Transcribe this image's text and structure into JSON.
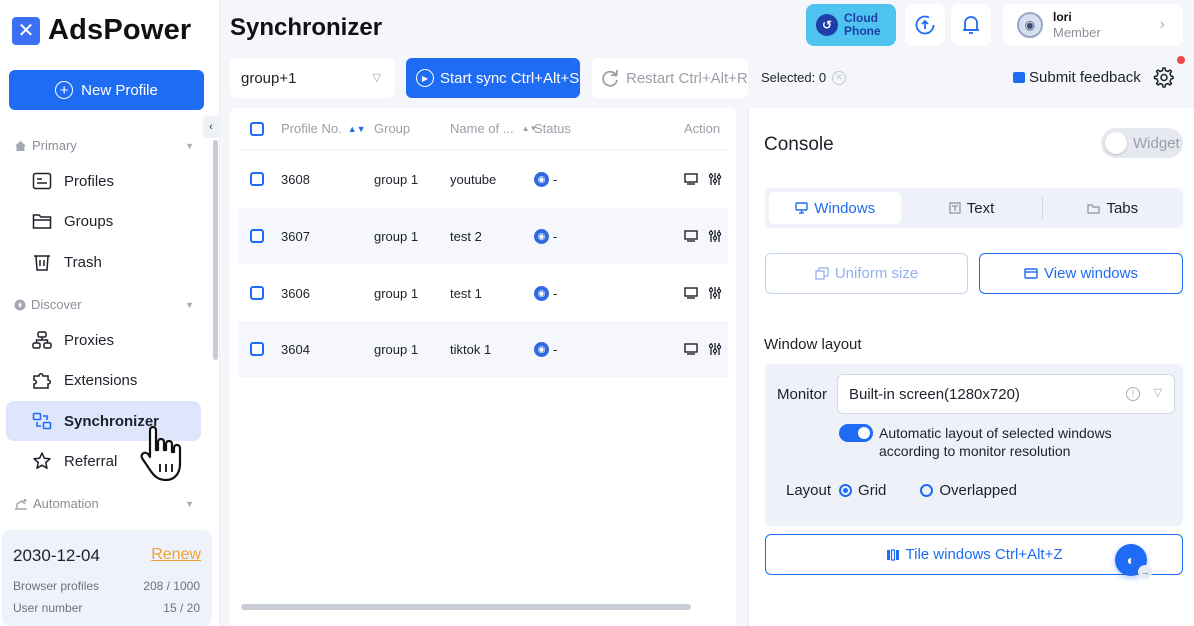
{
  "brand": {
    "name": "AdsPower"
  },
  "sidebar": {
    "new_profile_label": "New Profile",
    "collapse_glyph": "‹",
    "sections": [
      {
        "label": "Primary",
        "icon": "home-icon"
      },
      {
        "label": "Discover",
        "icon": "compass-icon"
      },
      {
        "label": "Automation",
        "icon": "automation-icon"
      }
    ],
    "items": [
      {
        "label": "Profiles",
        "icon": "profiles-icon"
      },
      {
        "label": "Groups",
        "icon": "folder-icon"
      },
      {
        "label": "Trash",
        "icon": "trash-icon"
      },
      {
        "label": "Proxies",
        "icon": "proxies-icon"
      },
      {
        "label": "Extensions",
        "icon": "puzzle-icon"
      },
      {
        "label": "Synchronizer",
        "icon": "sync-icon",
        "active": true
      },
      {
        "label": "Referral",
        "icon": "star-icon"
      }
    ],
    "account": {
      "expiry_date": "2030-12-04",
      "renew_label": "Renew",
      "browser_profiles_label": "Browser profiles",
      "browser_profiles_value": "208 / 1000",
      "user_number_label": "User number",
      "user_number_value": "15 / 20"
    }
  },
  "header": {
    "title": "Synchronizer",
    "cloud_phone": {
      "line1": "Cloud",
      "line2": "Phone"
    },
    "user": {
      "name": "lori",
      "role": "Member"
    }
  },
  "toolbar": {
    "group_value": "group+1",
    "start_sync_label": "Start sync Ctrl+Alt+S",
    "restart_label": "Restart Ctrl+Alt+R",
    "selected_label": "Selected: 0",
    "feedback_label": "Submit feedback"
  },
  "table": {
    "headers": {
      "profile_no": "Profile No.",
      "group": "Group",
      "name": "Name of ...",
      "status": "Status",
      "action": "Action"
    },
    "rows": [
      {
        "profile_no": "3608",
        "group": "group 1",
        "name": "youtube",
        "status": "-"
      },
      {
        "profile_no": "3607",
        "group": "group 1",
        "name": "test 2",
        "status": "-"
      },
      {
        "profile_no": "3606",
        "group": "group 1",
        "name": "test 1",
        "status": "-"
      },
      {
        "profile_no": "3604",
        "group": "group 1",
        "name": "tiktok 1",
        "status": "-"
      }
    ]
  },
  "console": {
    "title": "Console",
    "widget_label": "Widget",
    "tabs": [
      {
        "label": "Windows",
        "active": true
      },
      {
        "label": "Text"
      },
      {
        "label": "Tabs"
      }
    ],
    "uniform_size_label": "Uniform size",
    "view_windows_label": "View windows",
    "window_layout_label": "Window layout",
    "monitor_label": "Monitor",
    "monitor_value": "Built-in screen(1280x720)",
    "auto_layout_text": "Automatic layout of selected windows according to monitor resolution",
    "layout_label": "Layout",
    "layout_options": [
      {
        "label": "Grid",
        "selected": true
      },
      {
        "label": "Overlapped",
        "selected": false
      }
    ],
    "tile_label": "Tile windows Ctrl+Alt+Z"
  },
  "colors": {
    "accent": "#1e6cf3",
    "renew": "#f0a030",
    "cloud_phone_bg": "#4ec3f0"
  }
}
